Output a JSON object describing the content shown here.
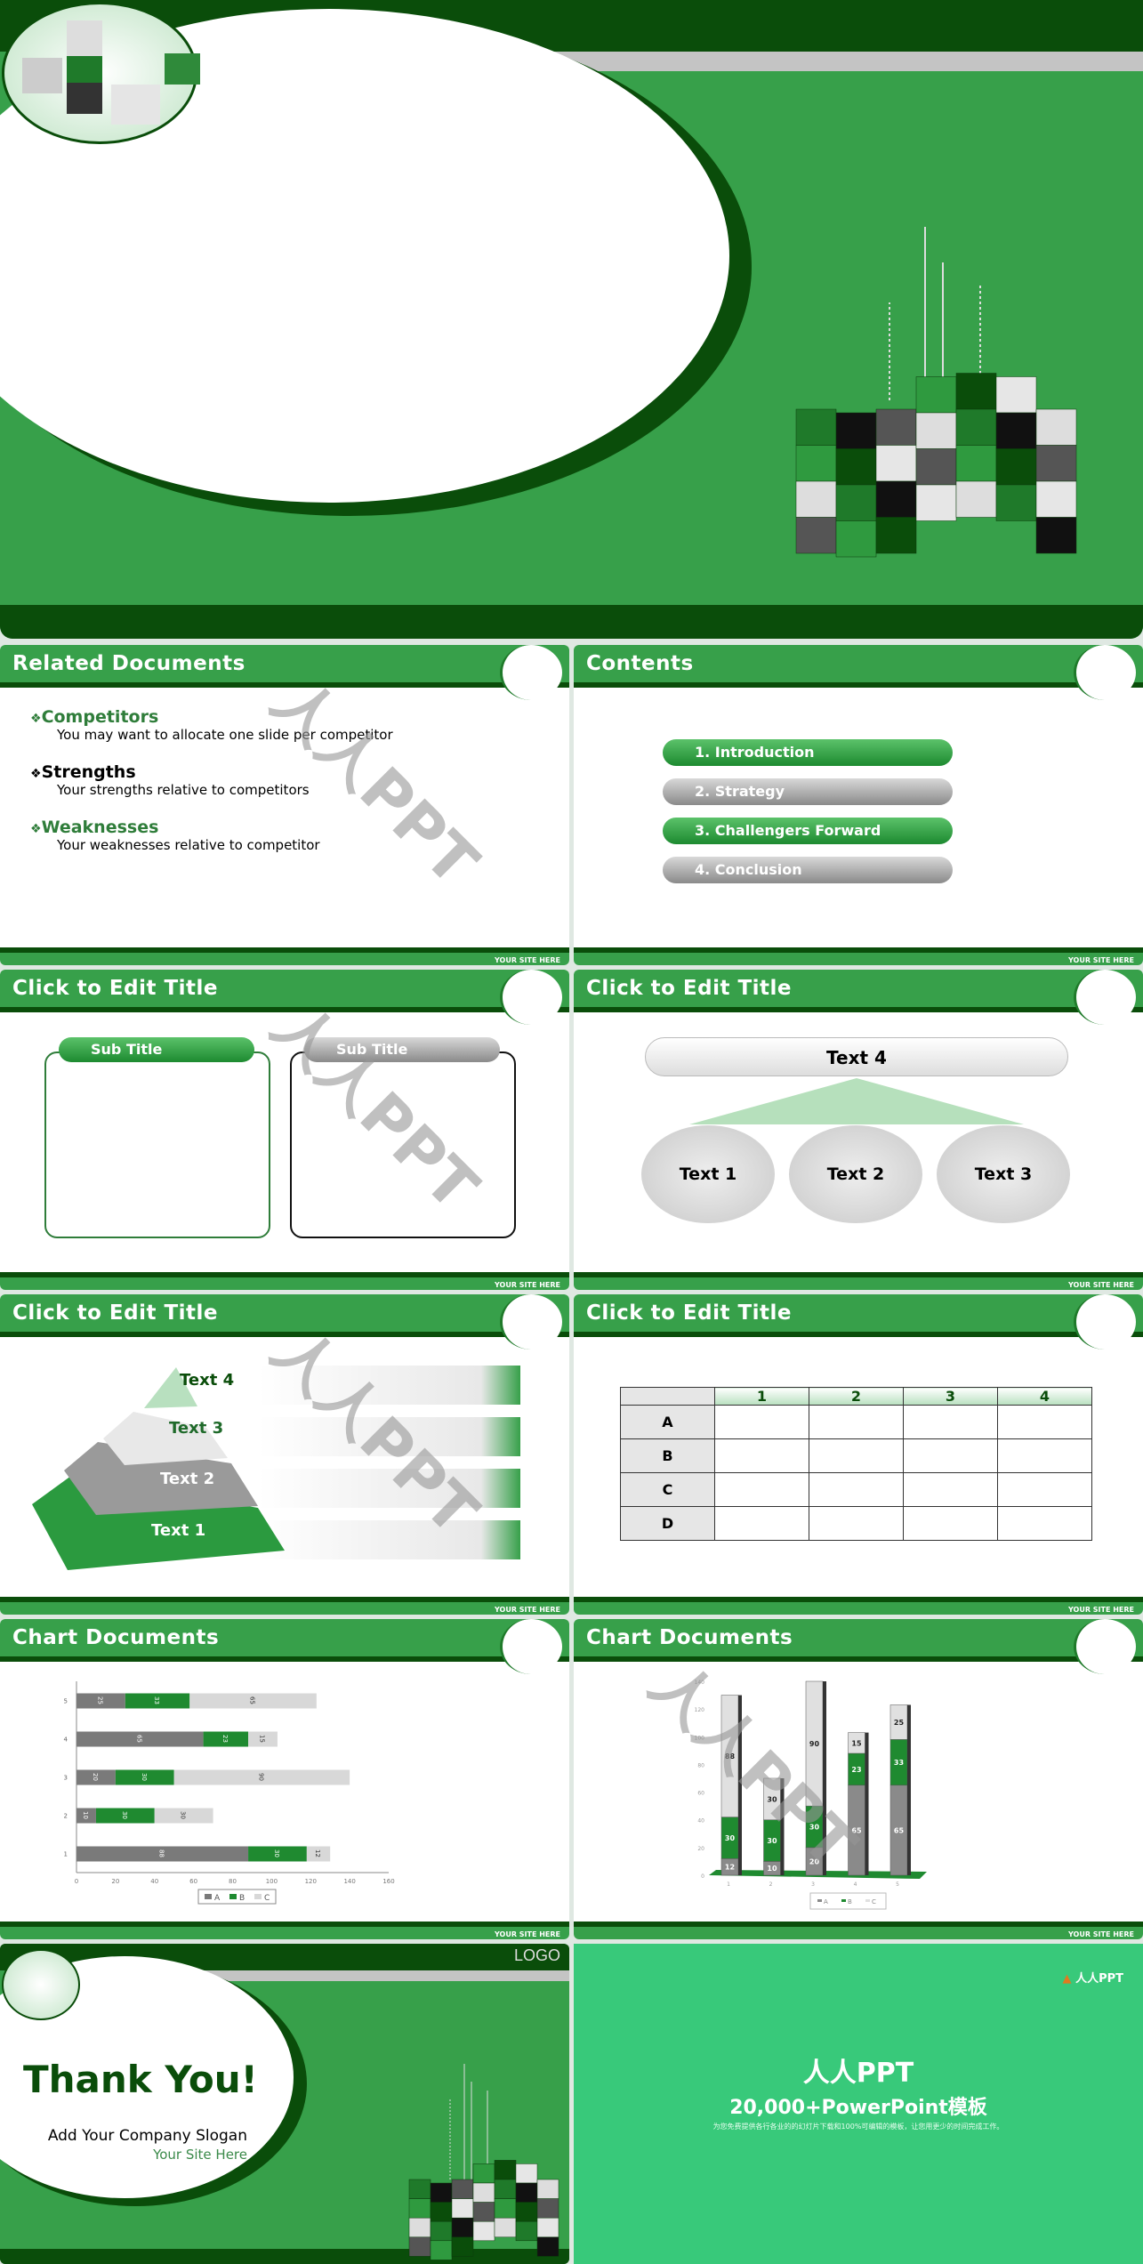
{
  "colors": {
    "green": "#37a04a",
    "dark_green": "#0a4d0a",
    "gray": "#8a8a8a",
    "promo_bg": "#38c97a"
  },
  "watermark": "人人PPT",
  "footer_text": "YOUR SITE HERE",
  "slides": {
    "related": {
      "title": "Related Documents",
      "items": [
        {
          "heading": "Competitors",
          "text": "You may want to allocate one slide per competitor",
          "color": "#2f7d3a"
        },
        {
          "heading": "Strengths",
          "text": "Your strengths relative to competitors",
          "color": "#000000"
        },
        {
          "heading": "Weaknesses",
          "text": "Your weaknesses relative to competitor",
          "color": "#2f7d3a"
        }
      ]
    },
    "contents": {
      "title": "Contents",
      "items": [
        "1. Introduction",
        "2. Strategy",
        "3. Challengers Forward",
        "4. Conclusion"
      ]
    },
    "subtitles": {
      "title": "Click to Edit Title",
      "sub1": "Sub Title",
      "sub2": "Sub Title"
    },
    "hierarchy": {
      "title": "Click to Edit Title",
      "top": "Text 4",
      "circles": [
        "Text 1",
        "Text 2",
        "Text 3"
      ]
    },
    "pyramid": {
      "title": "Click to Edit Title",
      "levels": [
        "Text 4",
        "Text 3",
        "Text 2",
        "Text 1"
      ]
    },
    "table": {
      "title": "Click to Edit Title",
      "columns": [
        "1",
        "2",
        "3",
        "4"
      ],
      "rows": [
        "A",
        "B",
        "C",
        "D"
      ]
    },
    "bar_chart": {
      "title": "Chart Documents"
    },
    "column_chart": {
      "title": "Chart Documents"
    },
    "thanks": {
      "logo": "LOGO",
      "title": "Thank You!",
      "slogan": "Add Your Company Slogan",
      "site": "Your Site Here"
    },
    "promo": {
      "brand": "人人PPT",
      "title": "人人PPT",
      "subtitle": "20,000+PowerPoint模板",
      "desc": "为您免费提供各行各业的的幻灯片下载和100%可编辑的模板，让您用更少的时间完成工作。"
    }
  },
  "chart_data": [
    {
      "type": "bar",
      "orientation": "horizontal",
      "stacked": true,
      "categories": [
        "1",
        "2",
        "3",
        "4",
        "5"
      ],
      "series": [
        {
          "name": "A",
          "values": [
            88,
            10,
            20,
            65,
            25
          ]
        },
        {
          "name": "B",
          "values": [
            30,
            30,
            30,
            23,
            33
          ]
        },
        {
          "name": "C",
          "values": [
            12,
            30,
            90,
            15,
            65
          ]
        }
      ],
      "xlim": [
        0,
        160
      ],
      "xticks": [
        0,
        20,
        40,
        60,
        80,
        100,
        120,
        140,
        160
      ],
      "legend": "bottom",
      "series_colors": [
        "#7a7a7a",
        "#1f8a30",
        "#d8d8d8"
      ]
    },
    {
      "type": "bar",
      "orientation": "vertical",
      "stacked": true,
      "categories": [
        "1",
        "2",
        "3",
        "4",
        "5"
      ],
      "series": [
        {
          "name": "A",
          "values": [
            12,
            10,
            20,
            65,
            65
          ]
        },
        {
          "name": "B",
          "values": [
            30,
            30,
            30,
            23,
            33
          ]
        },
        {
          "name": "C",
          "values": [
            88,
            30,
            90,
            15,
            25
          ]
        }
      ],
      "ylim": [
        0,
        140
      ],
      "yticks": [
        0,
        20,
        40,
        60,
        80,
        100,
        120,
        140
      ],
      "legend": "bottom",
      "series_colors": [
        "#8a8a8a",
        "#1f8a30",
        "#e0e0e0"
      ]
    }
  ]
}
